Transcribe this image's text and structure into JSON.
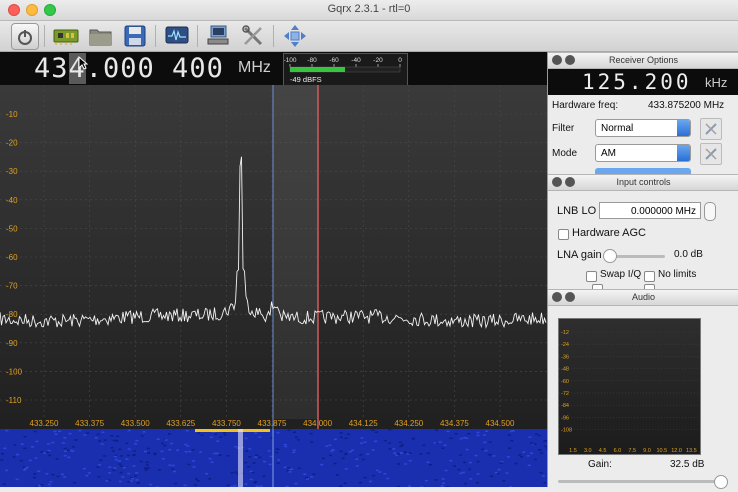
{
  "window": {
    "title": "Gqrx 2.3.1 - rtl=0"
  },
  "frequency": {
    "digits_before": "43",
    "digit_highlighted": "4",
    "digits_after": ".000 400",
    "unit": "MHz"
  },
  "meter": {
    "ticks": [
      "-100",
      "-80",
      "-60",
      "-40",
      "-20",
      "0"
    ],
    "reading": "-49 dBFS",
    "level_fraction": 0.5
  },
  "plot": {
    "y_ticks": [
      "-10",
      "-20",
      "-30",
      "-40",
      "-50",
      "-60",
      "-70",
      "-80",
      "-90",
      "-100",
      "-110"
    ],
    "x_ticks": [
      "433.250",
      "433.375",
      "433.500",
      "433.625",
      "433.750",
      "433.875",
      "434.000",
      "434.125",
      "434.250",
      "434.375",
      "434.500"
    ]
  },
  "receiver": {
    "header": "Receiver Options",
    "offset": "125.200",
    "offset_unit": "kHz",
    "hw_freq_label": "Hardware freq:",
    "hw_freq_value": "433.875200 MHz",
    "filter_label": "Filter",
    "filter_value": "Normal",
    "mode_label": "Mode",
    "mode_value": "AM"
  },
  "input": {
    "header": "Input controls",
    "lnb_label": "LNB LO",
    "lnb_value": "0.000000 MHz",
    "agc_label": "Hardware AGC",
    "lna_label": "LNA gain",
    "lna_value": "0.0 dB",
    "swap_label": "Swap I/Q",
    "nolimits_label": "No limits"
  },
  "audio": {
    "header": "Audio",
    "y_ticks": [
      "-12",
      "-24",
      "-36",
      "-48",
      "-60",
      "-72",
      "-84",
      "-96",
      "-108"
    ],
    "x_ticks": [
      "1.5",
      "3.0",
      "4.5",
      "6.0",
      "7.5",
      "9.0",
      "10.5",
      "12.0",
      "13.5"
    ],
    "gain_label": "Gain:",
    "gain_value": "32.5 dB",
    "gain_fraction": 0.95
  },
  "colors": {
    "accent": "#2a6fd6",
    "marker_blue": "#6a8fd8",
    "marker_red": "#d25a5a"
  }
}
